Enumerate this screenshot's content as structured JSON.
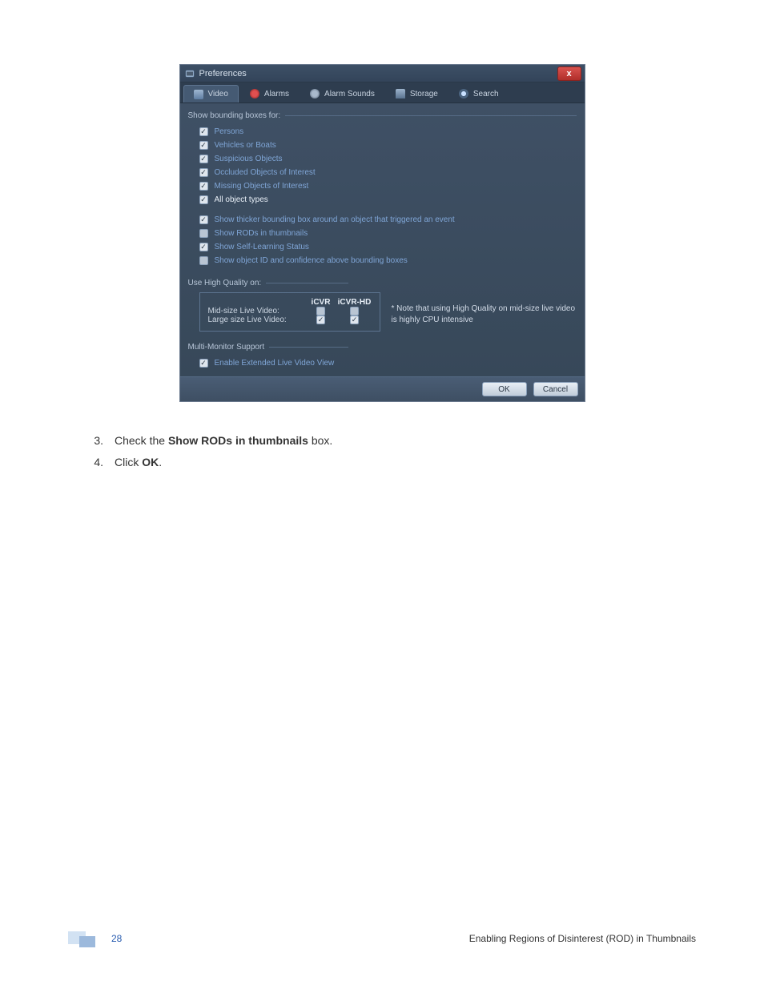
{
  "dialog": {
    "title": "Preferences",
    "close_glyph": "x",
    "tabs": [
      {
        "label": "Video",
        "active": true,
        "icon": "video"
      },
      {
        "label": "Alarms",
        "active": false,
        "icon": "alarms"
      },
      {
        "label": "Alarm Sounds",
        "active": false,
        "icon": "alarmsounds"
      },
      {
        "label": "Storage",
        "active": false,
        "icon": "storage"
      },
      {
        "label": "Search",
        "active": false,
        "icon": "search"
      }
    ],
    "bounding_section": {
      "header": "Show bounding boxes for:",
      "items": [
        {
          "label": "Persons",
          "checked": true,
          "white": false
        },
        {
          "label": "Vehicles or Boats",
          "checked": true,
          "white": false
        },
        {
          "label": "Suspicious Objects",
          "checked": true,
          "white": false
        },
        {
          "label": "Occluded Objects of Interest",
          "checked": true,
          "white": false
        },
        {
          "label": "Missing Objects of Interest",
          "checked": true,
          "white": false
        },
        {
          "label": "All object types",
          "checked": true,
          "white": true
        }
      ],
      "extra": [
        {
          "label": "Show thicker bounding box around an object that triggered an event",
          "checked": true
        },
        {
          "label": "Show RODs in thumbnails",
          "checked": false
        },
        {
          "label": "Show Self-Learning Status",
          "checked": true
        },
        {
          "label": "Show object ID and confidence above bounding boxes",
          "checked": false
        }
      ]
    },
    "quality_section": {
      "header": "Use High Quality on:",
      "col1": "iCVR",
      "col2": "iCVR-HD",
      "rows": [
        {
          "label": "Mid-size Live Video:",
          "c1": false,
          "c2": false
        },
        {
          "label": "Large size Live Video:",
          "c1": true,
          "c2": true
        }
      ],
      "note": "* Note that using High Quality on mid-size live video is highly CPU intensive"
    },
    "multimonitor_section": {
      "header": "Multi-Monitor Support",
      "item": {
        "label": "Enable Extended Live Video View",
        "checked": true
      }
    },
    "buttons": {
      "ok": "OK",
      "cancel": "Cancel"
    }
  },
  "doc": {
    "step3_num": "3.",
    "step3_pre": "Check the ",
    "step3_bold": "Show RODs in thumbnails",
    "step3_post": " box.",
    "step4_num": "4.",
    "step4_pre": "Click ",
    "step4_bold": "OK",
    "step4_post": "."
  },
  "footer": {
    "page_number": "28",
    "section_title": "Enabling Regions of Disinterest (ROD) in Thumbnails"
  }
}
